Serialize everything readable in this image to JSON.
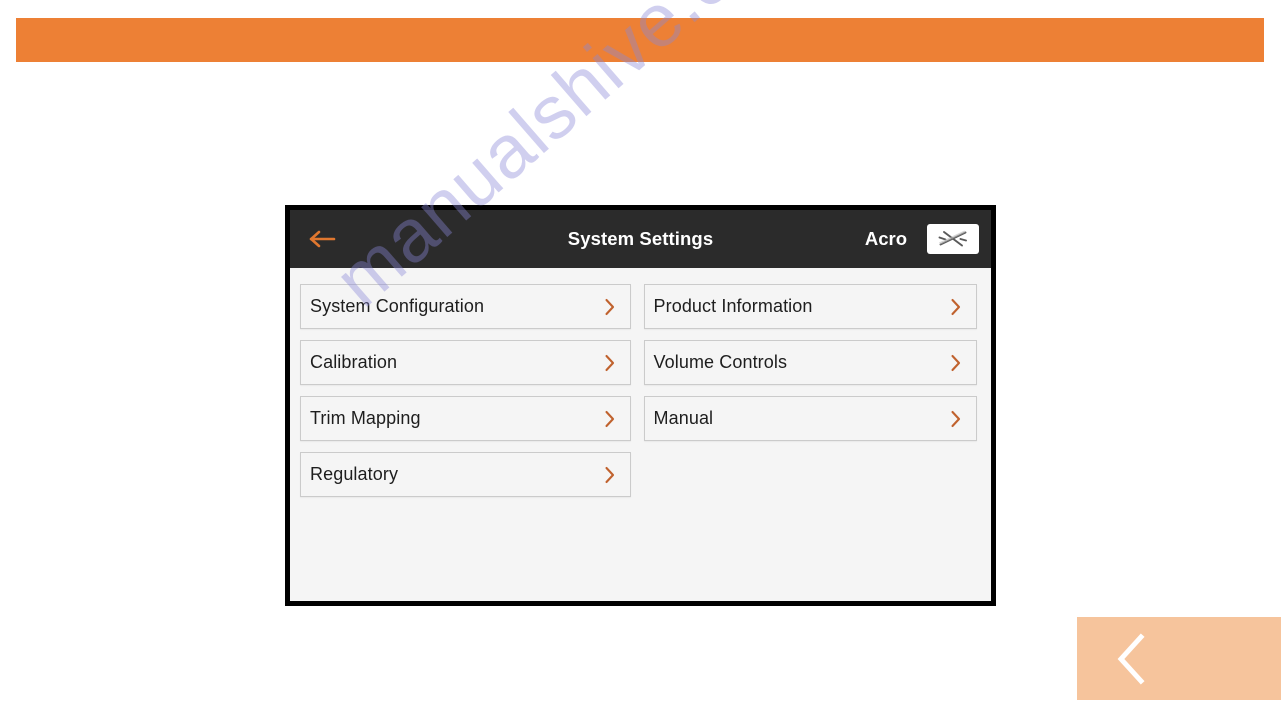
{
  "page": {
    "background_color": "#FFFFFF",
    "banner_color": "#ED8035",
    "watermark_text": "manualshive.com",
    "watermark_color": "#8A88D6"
  },
  "device": {
    "screen_background": "#F5F5F5",
    "bezel_color": "#000000",
    "title_bar": {
      "background": "#2B2B2B",
      "back_icon": "back-arrow-icon",
      "back_icon_color": "#E0772F",
      "title": "System Settings",
      "mode_label": "Acro",
      "aircraft_icon": "airplane-icon"
    },
    "menu": {
      "accent_color": "#C0622E",
      "chevron_icon": "chevron-right-icon",
      "left_column": [
        {
          "label": "System Configuration"
        },
        {
          "label": "Calibration"
        },
        {
          "label": "Trim Mapping"
        },
        {
          "label": "Regulatory"
        }
      ],
      "right_column": [
        {
          "label": "Product Information"
        },
        {
          "label": "Volume Controls"
        },
        {
          "label": "Manual"
        }
      ]
    }
  },
  "navigation": {
    "prev_page": {
      "icon": "chevron-left-icon",
      "background": "#F6C49C",
      "icon_color": "#FFFFFF"
    }
  }
}
